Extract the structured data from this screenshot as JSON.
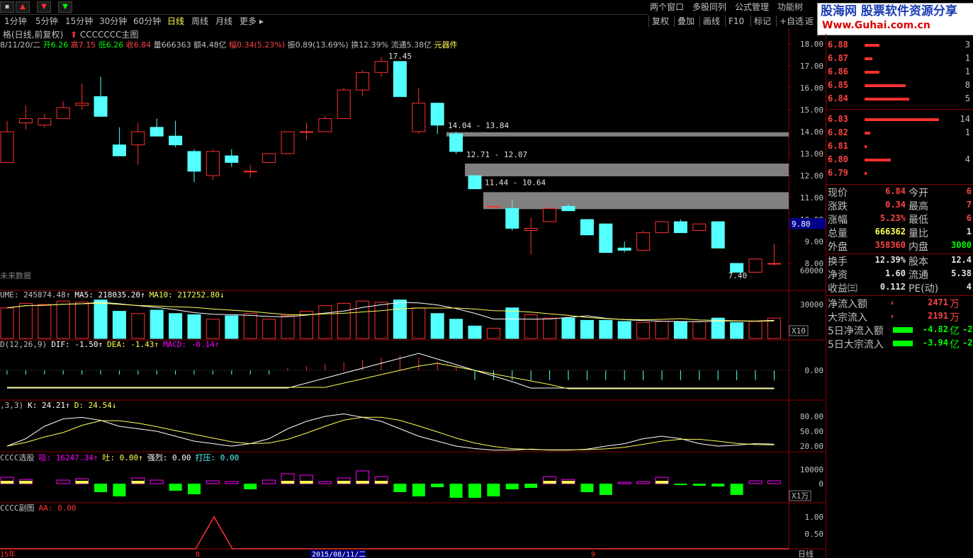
{
  "topbar": {
    "periods": [
      "1分钟",
      "5分钟",
      "15分钟",
      "30分钟",
      "60分钟",
      "日线",
      "周线",
      "月线",
      "更多 ▸"
    ],
    "active_period": "日线",
    "menus": [
      "两个窗口",
      "多股同列",
      "公式管理",
      "功能树"
    ]
  },
  "toolbar2": [
    "复权",
    "叠加",
    "画线",
    "F10",
    "标记",
    "+自选",
    "返"
  ],
  "logo": {
    "top": "股海网 股票软件资源分享",
    "url": "Www.Guhai.com.cn"
  },
  "stock": {
    "title": "格(日线,前复权)",
    "formula": "CCCCCCC主图",
    "date": "8/11/20/二",
    "open_label": "开",
    "open": "6.26",
    "high_label": "高",
    "high": "7.15",
    "low_label": "低",
    "low": "6.26",
    "close_label": "收",
    "close": "6.84",
    "vol_label": "量",
    "vol": "666363",
    "amount_label": "额",
    "amount": "4.48亿",
    "pct_label": "幅",
    "pct": "0.34(5.23%)",
    "amp_label": "振",
    "amp": "0.89(13.69%)",
    "turn_label": "换",
    "turn": "12.39%",
    "float_label": "流通",
    "float": "5.38亿",
    "sector": "元器件",
    "future_data": "未来数据"
  },
  "price_axis": [
    "18.00",
    "17.00",
    "16.00",
    "15.00",
    "14.00",
    "13.00",
    "12.00",
    "11.00",
    "10.00",
    "9.00",
    "8.00"
  ],
  "price_marker": "9.80",
  "annotations": {
    "high": "17.45",
    "low": "7.40",
    "gap1": "14.04 - 13.84",
    "gap2": "12.71 - 12.07",
    "gap3": "11.44 - 10.64"
  },
  "volume": {
    "label": "UME: 245874.48",
    "ma5": "MA5: 218035.20",
    "ma10": "MA10: 217252.80",
    "axis": [
      "60000",
      "30000"
    ],
    "unit": "X10"
  },
  "macd": {
    "label": "D(12,26,9)",
    "dif": "DIF: -1.50",
    "dea": "DEA: -1.43",
    "macd": "MACD: -0.14",
    "axis": [
      "0.00"
    ]
  },
  "kdj": {
    "label": ",3,3)",
    "k": "K: 24.21",
    "d": "D: 24.54",
    "axis": [
      "80.00",
      "50.00",
      "20.00"
    ]
  },
  "xg": {
    "label": "CCCC选股",
    "xi": "吸: 16247.34",
    "tu": "吐: 0.00",
    "qiang": "强烈: 0.00",
    "daya": "打压: 0.00",
    "axis": [
      "10000",
      "0"
    ],
    "unit": "X1万"
  },
  "fu": {
    "label": "CCCC副图",
    "aa": "AA: 0.00",
    "axis": [
      "1.00",
      "0.50"
    ]
  },
  "xaxis": {
    "start": "15年",
    "m8": "8",
    "date_hl": "2015/08/11/二",
    "m9": "9",
    "period": "日线"
  },
  "orderbook": {
    "sell": [
      {
        "price": "6.88",
        "vol": "3",
        "bar": 0.2
      },
      {
        "price": "6.87",
        "vol": "1",
        "bar": 0.1
      },
      {
        "price": "6.86",
        "vol": "1",
        "bar": 0.2
      },
      {
        "price": "6.85",
        "vol": "8",
        "bar": 0.55
      },
      {
        "price": "6.84",
        "vol": "5",
        "bar": 0.6
      }
    ],
    "buy": [
      {
        "price": "6.83",
        "vol": "14",
        "bar": 1.0
      },
      {
        "price": "6.82",
        "vol": "1",
        "bar": 0.08
      },
      {
        "price": "6.81",
        "vol": "",
        "bar": 0.03
      },
      {
        "price": "6.80",
        "vol": "4",
        "bar": 0.35
      },
      {
        "price": "6.79",
        "vol": "",
        "bar": 0.03
      }
    ]
  },
  "quote": [
    {
      "l1": "现价",
      "v1": "6.84",
      "l2": "今开",
      "v2": "6"
    },
    {
      "l1": "涨跌",
      "v1": "0.34",
      "l2": "最高",
      "v2": "7"
    },
    {
      "l1": "涨幅",
      "v1": "5.23%",
      "l2": "最低",
      "v2": "6"
    },
    {
      "l1": "总量",
      "v1": "666362",
      "l2": "量比",
      "v2": "1"
    },
    {
      "l1": "外盘",
      "v1": "358360",
      "l2": "内盘",
      "v2": "3080"
    },
    {
      "l1": "换手",
      "v1": "12.39%",
      "l2": "股本",
      "v2": "12.4"
    },
    {
      "l1": "净资",
      "v1": "1.60",
      "l2": "流通",
      "v2": "5.38"
    },
    {
      "l1": "收益㈢",
      "v1": "0.112",
      "l2": "PE(动)",
      "v2": "4"
    }
  ],
  "flow": [
    {
      "label": "净流入额",
      "value": "2471",
      "unit": "万"
    },
    {
      "label": "大宗流入",
      "value": "2191",
      "unit": "万"
    },
    {
      "label": "5日净流入额",
      "value": "-4.82",
      "unit": "亿",
      "extra": "-2"
    },
    {
      "label": "5日大宗流入",
      "value": "-3.94",
      "unit": "亿",
      "extra": "-2"
    }
  ],
  "colors": {
    "up": "#ff3030",
    "down": "#54ffff",
    "ma_white": "#ffffff",
    "ma_yellow": "#ffff54",
    "gap": "#808080"
  },
  "candles": [
    [
      12.6,
      14.5,
      12.8,
      14.0
    ],
    [
      14.4,
      15.2,
      14.1,
      14.6
    ],
    [
      14.3,
      14.8,
      14.2,
      14.6
    ],
    [
      14.6,
      15.4,
      14.6,
      15.1
    ],
    [
      15.2,
      16.2,
      15.0,
      15.3
    ],
    [
      15.6,
      16.5,
      14.8,
      14.7
    ],
    [
      13.4,
      14.2,
      12.9,
      12.9
    ],
    [
      13.4,
      14.4,
      12.5,
      14.0
    ],
    [
      14.2,
      14.6,
      13.8,
      13.8
    ],
    [
      13.8,
      14.5,
      13.3,
      13.4
    ],
    [
      13.1,
      13.2,
      11.7,
      12.2
    ],
    [
      12.0,
      13.2,
      11.8,
      13.1
    ],
    [
      12.9,
      13.2,
      12.4,
      12.6
    ],
    [
      12.2,
      12.5,
      11.9,
      12.2
    ],
    [
      12.6,
      13.0,
      12.6,
      13.0
    ],
    [
      13.0,
      14.0,
      13.0,
      14.0
    ],
    [
      14.0,
      14.4,
      13.6,
      14.0
    ],
    [
      14.0,
      14.7,
      14.0,
      14.6
    ],
    [
      14.6,
      16.0,
      14.6,
      15.9
    ],
    [
      15.9,
      16.8,
      15.6,
      16.7
    ],
    [
      16.7,
      17.4,
      16.5,
      17.2
    ],
    [
      17.2,
      17.2,
      15.6,
      15.6
    ],
    [
      14.0,
      16.0,
      13.9,
      15.3
    ],
    [
      15.3,
      15.3,
      13.9,
      14.3
    ],
    [
      13.9,
      14.0,
      13.0,
      13.1
    ],
    [
      12.0,
      12.0,
      11.4,
      11.4
    ],
    [
      10.6,
      10.6,
      10.6,
      10.6
    ],
    [
      10.5,
      10.9,
      9.5,
      9.6
    ],
    [
      9.5,
      10.1,
      8.4,
      9.6
    ],
    [
      9.9,
      10.7,
      9.9,
      10.5
    ],
    [
      10.6,
      10.7,
      10.4,
      10.4
    ],
    [
      10.0,
      10.0,
      9.3,
      9.3
    ],
    [
      9.8,
      9.8,
      8.5,
      8.5
    ],
    [
      8.7,
      9.0,
      8.5,
      8.6
    ],
    [
      8.6,
      9.5,
      8.6,
      9.4
    ],
    [
      9.4,
      9.9,
      9.4,
      9.9
    ],
    [
      9.9,
      10.0,
      9.4,
      9.4
    ],
    [
      9.5,
      9.8,
      9.5,
      9.8
    ],
    [
      9.9,
      9.9,
      8.7,
      8.7
    ],
    [
      8.0,
      8.0,
      7.6,
      7.6
    ],
    [
      7.6,
      8.2,
      7.6,
      8.2
    ],
    [
      8.0,
      8.9,
      7.9,
      8.0
    ]
  ],
  "vols": [
    27,
    31,
    30,
    33,
    32,
    34,
    24,
    22,
    25,
    22,
    21,
    17,
    20,
    22,
    17,
    20,
    24,
    29,
    31,
    33,
    32,
    34,
    27,
    22,
    17,
    11,
    9,
    27,
    21,
    18,
    18,
    16,
    16,
    15,
    14,
    15,
    15,
    15,
    18,
    14,
    15,
    18
  ]
}
